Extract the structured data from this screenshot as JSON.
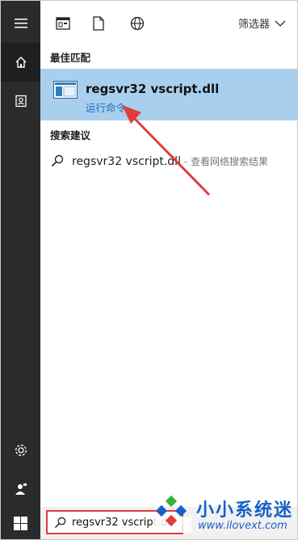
{
  "rail": {
    "items": [
      {
        "name": "hamburger-menu-button",
        "icon": "hamburger-icon"
      },
      {
        "name": "home-button",
        "icon": "home-icon"
      },
      {
        "name": "notebook-button",
        "icon": "notebook-icon"
      },
      {
        "name": "settings-button",
        "icon": "gear-icon"
      },
      {
        "name": "feedback-button",
        "icon": "person-feedback-icon"
      }
    ]
  },
  "toolbar": {
    "icons": [
      "apps-icon",
      "document-icon",
      "web-globe-icon"
    ],
    "filter_label": "筛选器"
  },
  "best_match": {
    "heading": "最佳匹配",
    "title": "regsvr32 vscript.dll",
    "subtitle": "运行命令",
    "icon": "run-command-icon"
  },
  "suggestions": {
    "heading": "搜索建议",
    "items": [
      {
        "query": "regsvr32 vscript.dll",
        "separator": " - ",
        "hint": "查看网络搜索结果"
      }
    ]
  },
  "taskbar": {
    "start_icon": "windows-logo-icon",
    "search_value": "regsvr32 vscript.dll"
  },
  "watermark": {
    "text": "小小系统迷",
    "url": "www.ilovext.com"
  },
  "colors": {
    "rail": "#2b2b2b",
    "highlight": "#a9cfee",
    "link": "#1f6fbf",
    "annotation": "#e23b3b",
    "watermark": "#1560c8"
  }
}
